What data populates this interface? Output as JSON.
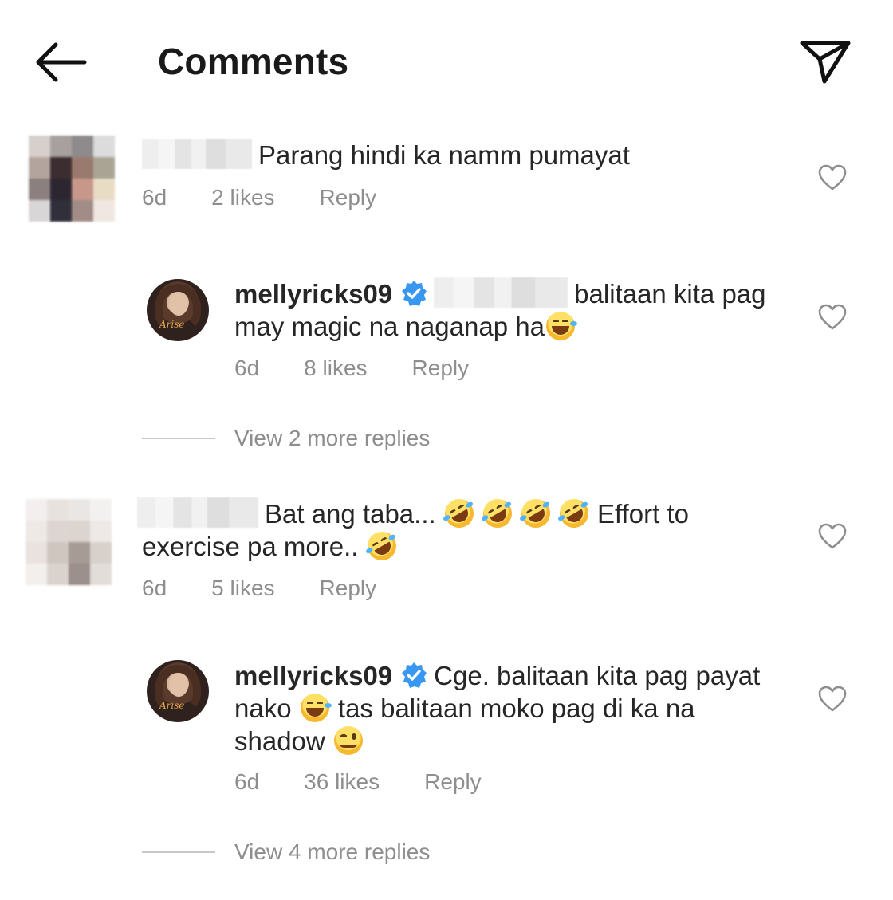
{
  "header": {
    "title": "Comments"
  },
  "comments": [
    {
      "text": "Parang hindi ka namm pumayat",
      "time": "6d",
      "likes": "2 likes",
      "reply": "Reply"
    },
    {
      "username": "mellyricks09",
      "text_line1": "balitaan kita pag",
      "text_line2": "may magic na naganap ha",
      "time": "6d",
      "likes": "8 likes",
      "reply": "Reply"
    },
    {
      "view_more": "View 2 more replies"
    },
    {
      "text_part1": "Bat ang taba...",
      "text_part2": "Effort to",
      "text_line2": "exercise pa more..",
      "time": "6d",
      "likes": "5 likes",
      "reply": "Reply"
    },
    {
      "username": "mellyricks09",
      "text_line1": "Cge. balitaan kita pag payat",
      "text_line2a": "nako",
      "text_line2b": "tas balitaan moko pag di ka na",
      "text_line3": "shadow",
      "time": "6d",
      "likes": "36 likes",
      "reply": "Reply"
    },
    {
      "view_more": "View 4 more replies"
    }
  ],
  "colors": {
    "text": "#262626",
    "secondary": "#8e8e8e",
    "verified": "#3897f0"
  },
  "icons": [
    "back-arrow-icon",
    "send-icon",
    "heart-icon",
    "verified-badge-icon"
  ]
}
